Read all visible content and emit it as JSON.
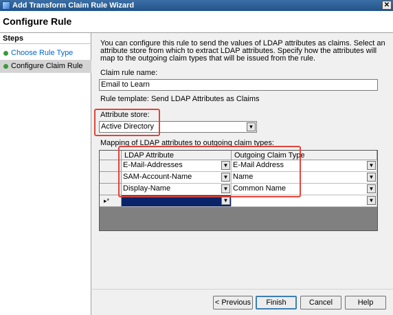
{
  "window": {
    "title": "Add Transform Claim Rule Wizard",
    "close_glyph": "✕"
  },
  "header": {
    "title": "Configure Rule"
  },
  "steps": {
    "title": "Steps",
    "items": [
      {
        "label": "Choose Rule Type",
        "state": "done"
      },
      {
        "label": "Configure Claim Rule",
        "state": "current"
      }
    ]
  },
  "main": {
    "description": "You can configure this rule to send the values of LDAP attributes as claims. Select an attribute store from which to extract LDAP attributes. Specify how the attributes will map to the outgoing claim types that will be issued from the rule.",
    "claim_rule_name_label": "Claim rule name:",
    "claim_rule_name_value": "Email to Learn",
    "rule_template_text": "Rule template: Send LDAP Attributes as Claims",
    "attribute_store_label": "Attribute store:",
    "attribute_store_value": "Active Directory",
    "mapping_label": "Mapping of LDAP attributes to outgoing claim types:",
    "grid": {
      "columns": [
        "LDAP Attribute",
        "Outgoing Claim Type"
      ],
      "rows": [
        {
          "ldap": "E-Mail-Addresses",
          "claim": "E-Mail Address"
        },
        {
          "ldap": "SAM-Account-Name",
          "claim": "Name"
        },
        {
          "ldap": "Display-Name",
          "claim": "Common Name"
        }
      ],
      "new_row_marker": "▸*"
    }
  },
  "buttons": {
    "previous": "< Previous",
    "finish": "Finish",
    "cancel": "Cancel",
    "help": "Help"
  },
  "colors": {
    "highlight": "#e0443a",
    "selected": "#0a246a",
    "link": "#0066cc"
  }
}
